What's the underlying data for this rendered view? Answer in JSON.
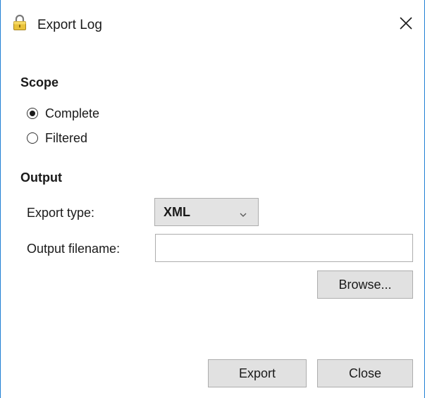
{
  "window": {
    "title": "Export Log",
    "title_icon": "lock-icon",
    "close_icon": "close-icon"
  },
  "scope": {
    "heading": "Scope",
    "options": [
      {
        "label": "Complete",
        "selected": true
      },
      {
        "label": "Filtered",
        "selected": false
      }
    ]
  },
  "output": {
    "heading": "Output",
    "export_type_label": "Export type:",
    "export_type_value": "XML",
    "filename_label": "Output filename:",
    "filename_value": "",
    "filename_placeholder": "",
    "browse_label": "Browse..."
  },
  "footer": {
    "export_label": "Export",
    "close_label": "Close"
  },
  "colors": {
    "window_border": "#1f7fd4",
    "button_face": "#e1e1e1",
    "button_border": "#adadad"
  }
}
